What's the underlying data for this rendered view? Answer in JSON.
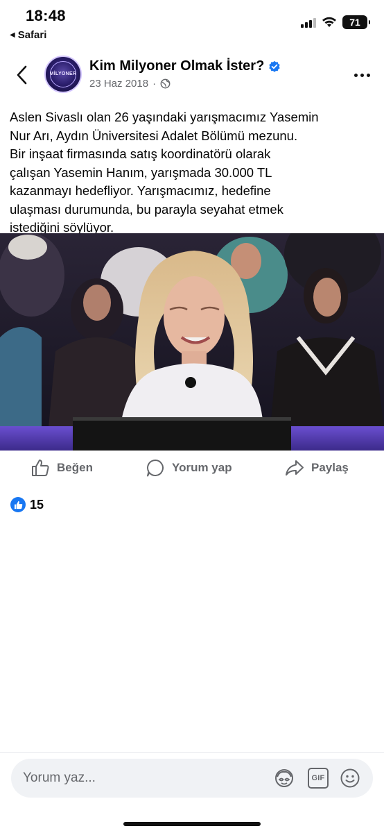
{
  "status_bar": {
    "time": "18:48",
    "back_app_label": "Safari",
    "battery_level": "71",
    "icons": [
      "signal-icon",
      "wifi-icon",
      "battery-icon"
    ]
  },
  "post": {
    "page_name": "Kim Milyoner Olmak İster?",
    "verified_icon": "verified-badge-icon",
    "date": "23 Haz 2018",
    "audience_icon": "globe-icon",
    "avatar_text": "MİLYONER",
    "caption": "Aslen Sivaslı olan 26 yaşındaki yarışmacımız Yasemin\nNur Arı, Aydın Üniversitesi Adalet Bölümü mezunu.\nBir inşaat firmasında satış koordinatörü olarak\nçalışan Yasemin Hanım, yarışmada 30.000 TL\nkazanmayı hedefliyor. Yarışmacımız, hedefine\nulaşması durumunda, bu parayla seyahat etmek\nistediğini söylüyor.",
    "photo_description_icon": "contestant-photo"
  },
  "actions": {
    "like_label": "Beğen",
    "comment_label": "Yorum yap",
    "share_label": "Paylaş"
  },
  "reactions": {
    "count": "15",
    "icon": "like-reaction-icon"
  },
  "comment_bar": {
    "placeholder": "Yorum yaz...",
    "icons": [
      "avatar-sticker-icon",
      "gif-icon",
      "emoji-icon"
    ],
    "gif_label": "GIF"
  },
  "colors": {
    "facebook_blue": "#1877f2",
    "secondary_text": "#65676b",
    "input_bg": "#f0f2f5"
  }
}
